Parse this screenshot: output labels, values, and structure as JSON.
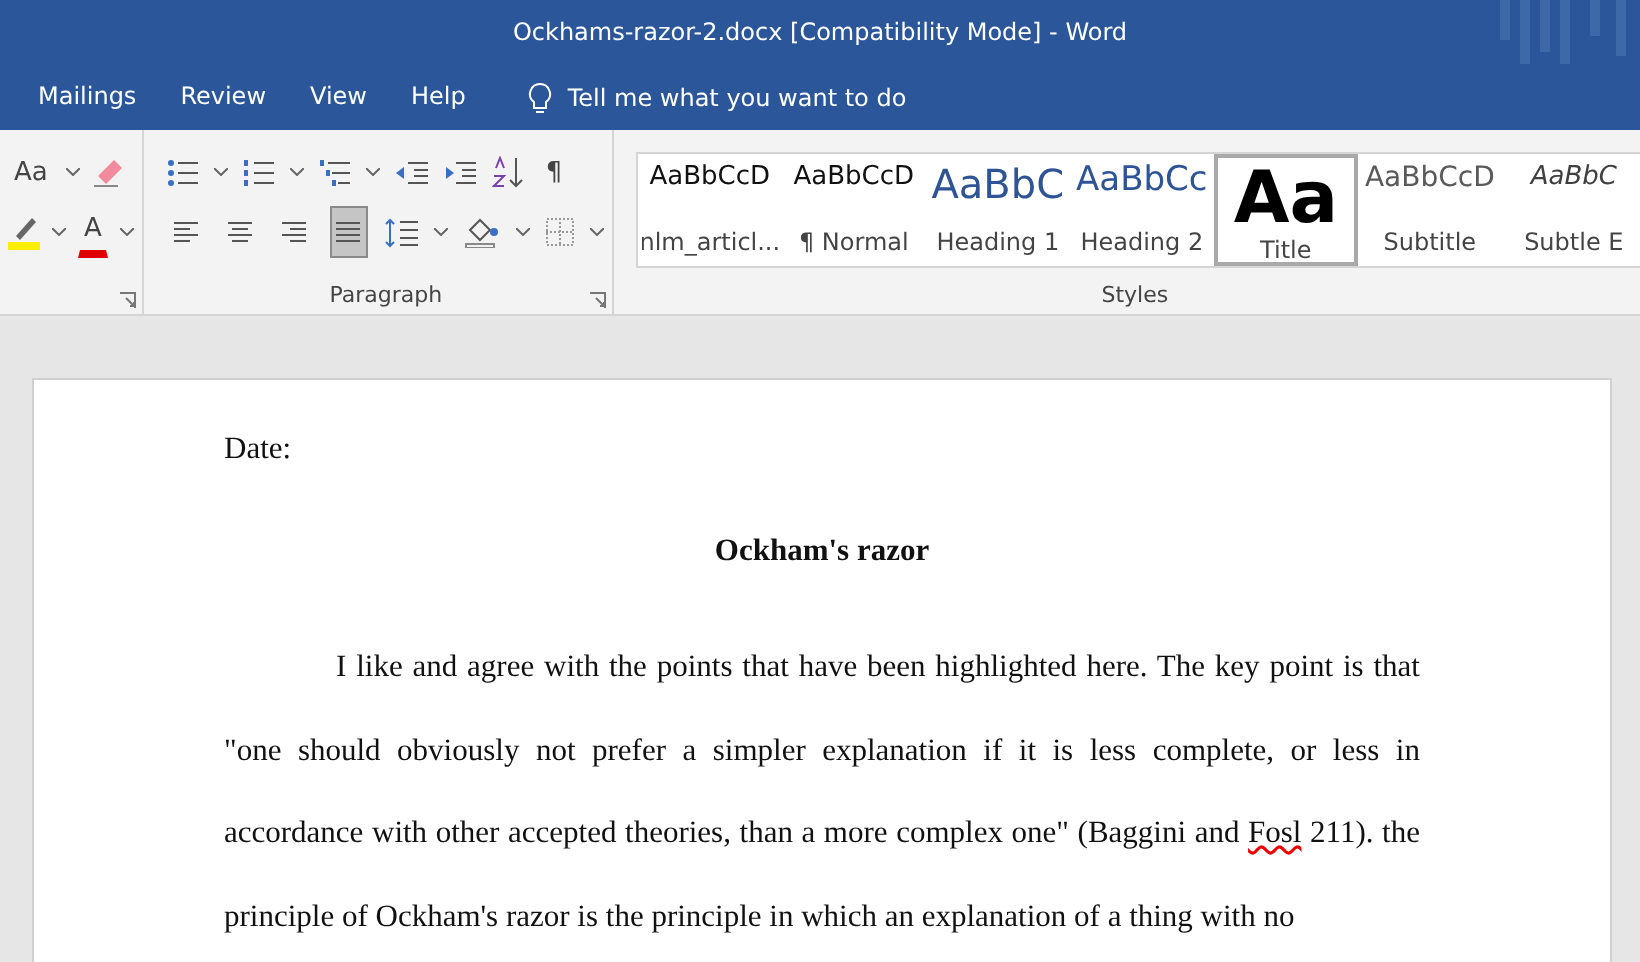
{
  "window": {
    "title": "Ockhams-razor-2.docx [Compatibility Mode]  -  Word"
  },
  "tabs": [
    {
      "label": "Mailings",
      "selected": false
    },
    {
      "label": "Review",
      "selected": false
    },
    {
      "label": "View",
      "selected": false
    },
    {
      "label": "Help",
      "selected": false
    }
  ],
  "tell_me": {
    "placeholder": "Tell me what you want to do"
  },
  "font_group": {
    "change_case": "Aa",
    "font_color_letter": "A"
  },
  "paragraph_group": {
    "label": "Paragraph",
    "show_marks": "¶",
    "alignments": [
      {
        "kind": "left",
        "selected": false
      },
      {
        "kind": "center",
        "selected": false
      },
      {
        "kind": "right",
        "selected": false
      },
      {
        "kind": "justify",
        "selected": true
      }
    ]
  },
  "styles_group": {
    "label": "Styles",
    "items": [
      {
        "preview": "AaBbCcD",
        "label": "nlm_articl...",
        "kind": "body",
        "selected": false
      },
      {
        "preview": "AaBbCcD",
        "label": "¶ Normal",
        "kind": "body",
        "selected": false
      },
      {
        "preview": "AaBbC",
        "label": "Heading 1",
        "kind": "heading1",
        "selected": false
      },
      {
        "preview": "AaBbCc",
        "label": "Heading 2",
        "kind": "heading2",
        "selected": false
      },
      {
        "preview": "Aa",
        "label": "Title",
        "kind": "title",
        "selected": true
      },
      {
        "preview": "AaBbCcD",
        "label": "Subtitle",
        "kind": "subtitle",
        "selected": false
      },
      {
        "preview": "AaBbC",
        "label": "Subtle E",
        "kind": "emphasis",
        "selected": false
      }
    ]
  },
  "document": {
    "date_line": "Date:",
    "title": "Ockham's razor",
    "paragraph": [
      {
        "text": "I like and agree with the points that have been highlighted here. The key point is that \"one should obviously not prefer a simpler explanation if it is less complete, or less in accordance with other accepted theories, than a more complex one\" (Baggini and ",
        "misspelled": false
      },
      {
        "text": "Fosl",
        "misspelled": true
      },
      {
        "text": " 211). the principle of Ockham's razor is the principle in which an explanation of a thing with no",
        "misspelled": false
      }
    ]
  }
}
